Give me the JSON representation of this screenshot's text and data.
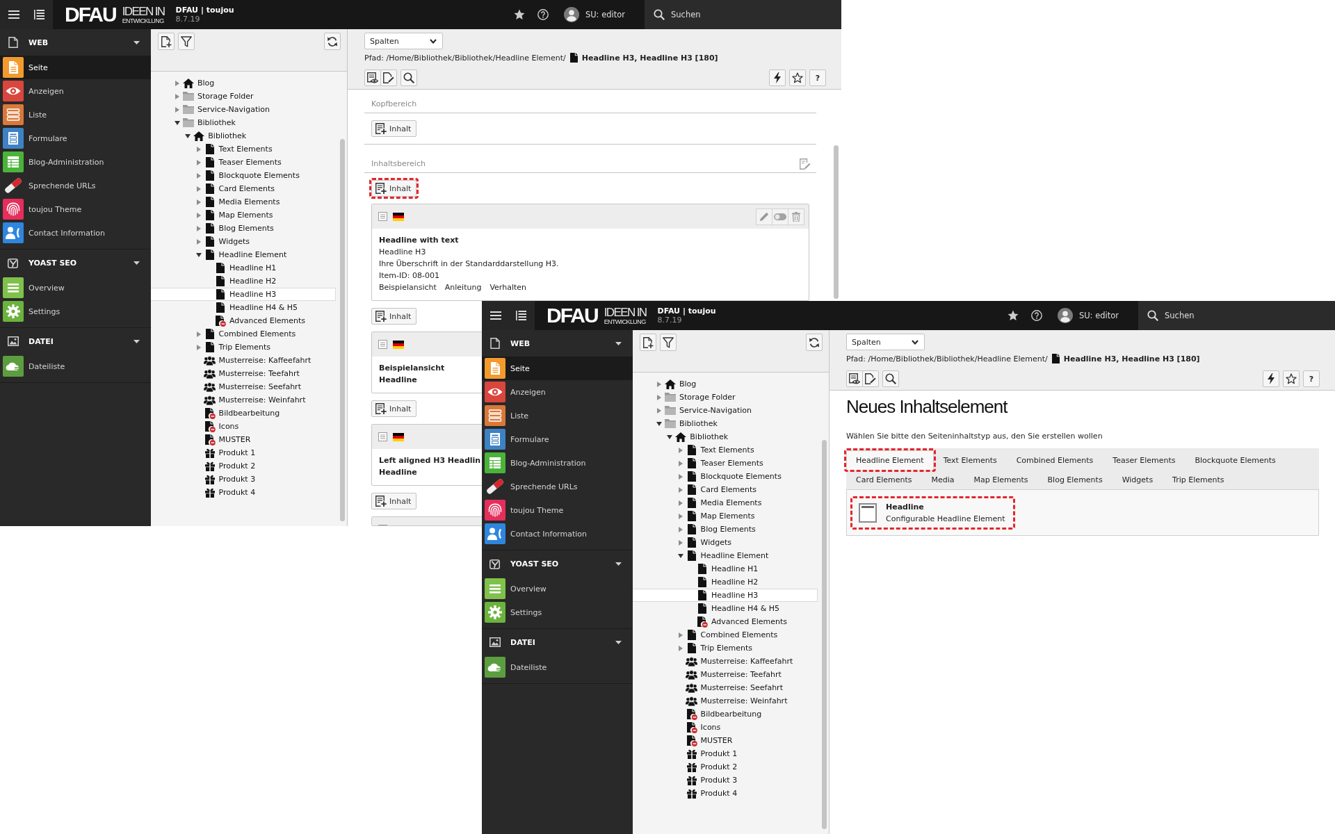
{
  "windows": [
    {
      "topbar": {
        "logo": {
          "wordmark": "DFAU",
          "tagline": "IDEEN IN",
          "subline": "ENTWICKLUNG"
        },
        "site_name": "DFAU | toujou",
        "version": "8.7.19",
        "user": "SU: editor",
        "search": "Suchen"
      },
      "sidebar": [
        {
          "title": "WEB",
          "kind": "web",
          "expanded": true,
          "items": [
            {
              "label": "Seite",
              "kind": "page",
              "color": "#f29a2e",
              "selected": true
            },
            {
              "label": "Anzeigen",
              "kind": "view",
              "color": "#d9463e",
              "selected": false
            },
            {
              "label": "Liste",
              "kind": "list",
              "color": "#d9783a",
              "selected": false
            },
            {
              "label": "Formulare",
              "kind": "form",
              "color": "#3d82c4",
              "selected": false
            },
            {
              "label": "Blog-Administration",
              "kind": "blog",
              "color": "#4bb33a",
              "selected": false
            },
            {
              "label": "Sprechende URLs",
              "kind": "urls",
              "selected": false
            },
            {
              "label": "toujou Theme",
              "kind": "theme",
              "color": "#e62e5c",
              "selected": false
            },
            {
              "label": "Contact Information",
              "kind": "contact",
              "color": "#2e86de",
              "selected": false
            }
          ]
        },
        {
          "title": "YOAST SEO",
          "kind": "seo",
          "expanded": true,
          "items": [
            {
              "label": "Overview",
              "kind": "overview",
              "color": "#7fc14b",
              "selected": false
            },
            {
              "label": "Settings",
              "kind": "settings",
              "color": "#6cb33e",
              "selected": false
            }
          ]
        },
        {
          "title": "DATEI",
          "kind": "file",
          "expanded": true,
          "items": [
            {
              "label": "Dateiliste",
              "kind": "filelist",
              "color": "#5c9e3f",
              "selected": false
            }
          ]
        }
      ],
      "page_tree": [
        {
          "label": "Blog",
          "kind": "root",
          "expanded": false,
          "selected": false
        },
        {
          "label": "Storage Folder",
          "kind": "folder",
          "expanded": false,
          "selected": false
        },
        {
          "label": "Service-Navigation",
          "kind": "folder",
          "expanded": false,
          "selected": false
        },
        {
          "label": "Bibliothek",
          "kind": "folder",
          "expanded": true,
          "selected": false,
          "children": [
            {
              "label": "Bibliothek",
              "kind": "root",
              "expanded": true,
              "selected": false,
              "children": [
                {
                  "label": "Text Elements",
                  "kind": "page",
                  "expanded": false,
                  "selected": false
                },
                {
                  "label": "Teaser Elements",
                  "kind": "page",
                  "expanded": false,
                  "selected": false
                },
                {
                  "label": "Blockquote Elements",
                  "kind": "page",
                  "expanded": false,
                  "selected": false
                },
                {
                  "label": "Card Elements",
                  "kind": "page",
                  "expanded": false,
                  "selected": false
                },
                {
                  "label": "Media Elements",
                  "kind": "page",
                  "expanded": false,
                  "selected": false
                },
                {
                  "label": "Map Elements",
                  "kind": "page",
                  "expanded": false,
                  "selected": false
                },
                {
                  "label": "Blog Elements",
                  "kind": "page",
                  "expanded": false,
                  "selected": false
                },
                {
                  "label": "Widgets",
                  "kind": "page",
                  "expanded": false,
                  "selected": false
                },
                {
                  "label": "Headline Element",
                  "kind": "page",
                  "expanded": true,
                  "selected": false,
                  "children": [
                    {
                      "label": "Headline H1",
                      "kind": "page",
                      "selected": false
                    },
                    {
                      "label": "Headline H2",
                      "kind": "page",
                      "selected": false
                    },
                    {
                      "label": "Headline H3",
                      "kind": "page",
                      "selected": true
                    },
                    {
                      "label": "Headline H4 & H5",
                      "kind": "page",
                      "selected": false
                    },
                    {
                      "label": "Advanced Elements",
                      "kind": "hidden",
                      "selected": false
                    }
                  ]
                },
                {
                  "label": "Combined Elements",
                  "kind": "page",
                  "expanded": false,
                  "selected": false
                },
                {
                  "label": "Trip Elements",
                  "kind": "page",
                  "expanded": false,
                  "selected": false
                },
                {
                  "label": "Musterreise: Kaffeefahrt",
                  "kind": "group",
                  "selected": false
                },
                {
                  "label": "Musterreise: Teefahrt",
                  "kind": "group",
                  "selected": false
                },
                {
                  "label": "Musterreise: Seefahrt",
                  "kind": "group",
                  "selected": false
                },
                {
                  "label": "Musterreise: Weinfahrt",
                  "kind": "group",
                  "selected": false
                },
                {
                  "label": "Bildbearbeitung",
                  "kind": "hidden",
                  "selected": false
                },
                {
                  "label": "Icons",
                  "kind": "hidden",
                  "selected": false
                },
                {
                  "label": "MUSTER",
                  "kind": "hidden",
                  "selected": false
                },
                {
                  "label": "Produkt 1",
                  "kind": "gift",
                  "selected": false
                },
                {
                  "label": "Produkt 2",
                  "kind": "gift",
                  "selected": false
                },
                {
                  "label": "Produkt 3",
                  "kind": "gift",
                  "selected": false
                },
                {
                  "label": "Produkt 4",
                  "kind": "gift",
                  "selected": false
                }
              ]
            }
          ]
        }
      ],
      "docheader": {
        "view_select": "Spalten",
        "path": "Pfad: /Home/Bibliothek/Bibliothek/Headline Element/",
        "page_title": "Headline H3, Headline H3 [180]",
        "help": "?"
      },
      "content": {
        "kind": "page_layout",
        "columns": [
          {
            "title": "Kopfbereich",
            "editable": false,
            "items": [
              {
                "kind": "add",
                "label": "Inhalt",
                "highlighted": false
              }
            ]
          },
          {
            "title": "Inhaltsbereich",
            "editable": true,
            "items": [
              {
                "kind": "add",
                "label": "Inhalt",
                "highlighted": true
              },
              {
                "kind": "card",
                "title_lines": [
                  "Headline with text"
                ],
                "lines": [
                  "Headline H3",
                  "Ihre Überschrift in der Standarddarstellung H3.",
                  "Item-ID: 08-001"
                ],
                "tags": [
                  "Beispielansicht",
                  "Anleitung",
                  "Verhalten"
                ]
              },
              {
                "kind": "add",
                "label": "Inhalt",
                "highlighted": false
              },
              {
                "kind": "card",
                "title_lines": [
                  "Beispielansicht",
                  "Headline"
                ]
              },
              {
                "kind": "add",
                "label": "Inhalt",
                "highlighted": false
              },
              {
                "kind": "card",
                "title_lines": [
                  "Left aligned H3 Headlin",
                  "Headline"
                ]
              },
              {
                "kind": "add",
                "label": "Inhalt",
                "highlighted": false
              },
              {
                "kind": "card"
              }
            ]
          }
        ]
      }
    },
    {
      "topbar": {
        "logo": {
          "wordmark": "DFAU",
          "tagline": "IDEEN IN",
          "subline": "ENTWICKLUNG"
        },
        "site_name": "DFAU | toujou",
        "version": "8.7.19",
        "user": "SU: editor",
        "search": "Suchen"
      },
      "sidebar": [
        {
          "title": "WEB",
          "kind": "web",
          "expanded": true,
          "items": [
            {
              "label": "Seite",
              "kind": "page",
              "color": "#f29a2e",
              "selected": true
            },
            {
              "label": "Anzeigen",
              "kind": "view",
              "color": "#d9463e",
              "selected": false
            },
            {
              "label": "Liste",
              "kind": "list",
              "color": "#d9783a",
              "selected": false
            },
            {
              "label": "Formulare",
              "kind": "form",
              "color": "#3d82c4",
              "selected": false
            },
            {
              "label": "Blog-Administration",
              "kind": "blog",
              "color": "#4bb33a",
              "selected": false
            },
            {
              "label": "Sprechende URLs",
              "kind": "urls",
              "selected": false
            },
            {
              "label": "toujou Theme",
              "kind": "theme",
              "color": "#e62e5c",
              "selected": false
            },
            {
              "label": "Contact Information",
              "kind": "contact",
              "color": "#2e86de",
              "selected": false
            }
          ]
        },
        {
          "title": "YOAST SEO",
          "kind": "seo",
          "expanded": true,
          "items": [
            {
              "label": "Overview",
              "kind": "overview",
              "color": "#7fc14b",
              "selected": false
            },
            {
              "label": "Settings",
              "kind": "settings",
              "color": "#6cb33e",
              "selected": false
            }
          ]
        },
        {
          "title": "DATEI",
          "kind": "file",
          "expanded": true,
          "items": [
            {
              "label": "Dateiliste",
              "kind": "filelist",
              "color": "#5c9e3f",
              "selected": false
            }
          ]
        }
      ],
      "page_tree": [
        {
          "label": "Blog",
          "kind": "root",
          "expanded": false,
          "selected": false
        },
        {
          "label": "Storage Folder",
          "kind": "folder",
          "expanded": false,
          "selected": false
        },
        {
          "label": "Service-Navigation",
          "kind": "folder",
          "expanded": false,
          "selected": false
        },
        {
          "label": "Bibliothek",
          "kind": "folder",
          "expanded": true,
          "selected": false,
          "children": [
            {
              "label": "Bibliothek",
              "kind": "root",
              "expanded": true,
              "selected": false,
              "children": [
                {
                  "label": "Text Elements",
                  "kind": "page",
                  "expanded": false,
                  "selected": false
                },
                {
                  "label": "Teaser Elements",
                  "kind": "page",
                  "expanded": false,
                  "selected": false
                },
                {
                  "label": "Blockquote Elements",
                  "kind": "page",
                  "expanded": false,
                  "selected": false
                },
                {
                  "label": "Card Elements",
                  "kind": "page",
                  "expanded": false,
                  "selected": false
                },
                {
                  "label": "Media Elements",
                  "kind": "page",
                  "expanded": false,
                  "selected": false
                },
                {
                  "label": "Map Elements",
                  "kind": "page",
                  "expanded": false,
                  "selected": false
                },
                {
                  "label": "Blog Elements",
                  "kind": "page",
                  "expanded": false,
                  "selected": false
                },
                {
                  "label": "Widgets",
                  "kind": "page",
                  "expanded": false,
                  "selected": false
                },
                {
                  "label": "Headline Element",
                  "kind": "page",
                  "expanded": true,
                  "selected": false,
                  "children": [
                    {
                      "label": "Headline H1",
                      "kind": "page",
                      "selected": false
                    },
                    {
                      "label": "Headline H2",
                      "kind": "page",
                      "selected": false
                    },
                    {
                      "label": "Headline H3",
                      "kind": "page",
                      "selected": true
                    },
                    {
                      "label": "Headline H4 & H5",
                      "kind": "page",
                      "selected": false
                    },
                    {
                      "label": "Advanced Elements",
                      "kind": "hidden",
                      "selected": false
                    }
                  ]
                },
                {
                  "label": "Combined Elements",
                  "kind": "page",
                  "expanded": false,
                  "selected": false
                },
                {
                  "label": "Trip Elements",
                  "kind": "page",
                  "expanded": false,
                  "selected": false
                },
                {
                  "label": "Musterreise: Kaffeefahrt",
                  "kind": "group",
                  "selected": false
                },
                {
                  "label": "Musterreise: Teefahrt",
                  "kind": "group",
                  "selected": false
                },
                {
                  "label": "Musterreise: Seefahrt",
                  "kind": "group",
                  "selected": false
                },
                {
                  "label": "Musterreise: Weinfahrt",
                  "kind": "group",
                  "selected": false
                },
                {
                  "label": "Bildbearbeitung",
                  "kind": "hidden",
                  "selected": false
                },
                {
                  "label": "Icons",
                  "kind": "hidden",
                  "selected": false
                },
                {
                  "label": "MUSTER",
                  "kind": "hidden",
                  "selected": false
                },
                {
                  "label": "Produkt 1",
                  "kind": "gift",
                  "selected": false
                },
                {
                  "label": "Produkt 2",
                  "kind": "gift",
                  "selected": false
                },
                {
                  "label": "Produkt 3",
                  "kind": "gift",
                  "selected": false
                },
                {
                  "label": "Produkt 4",
                  "kind": "gift",
                  "selected": false
                }
              ]
            }
          ]
        }
      ],
      "docheader": {
        "view_select": "Spalten",
        "path": "Pfad: /Home/Bibliothek/Bibliothek/Headline Element/",
        "page_title": "Headline H3, Headline H3 [180]",
        "help": "?"
      },
      "content": {
        "kind": "wizard",
        "title": "Neues Inhaltselement",
        "intro": "Wählen Sie bitte den Seiteninhaltstyp aus, den Sie erstellen wollen",
        "tabs": [
          {
            "label": "Headline Element",
            "selected": true,
            "highlighted": true
          },
          {
            "label": "Text Elements",
            "selected": false,
            "highlighted": false
          },
          {
            "label": "Combined Elements",
            "selected": false,
            "highlighted": false
          },
          {
            "label": "Teaser Elements",
            "selected": false,
            "highlighted": false
          },
          {
            "label": "Blockquote Elements",
            "selected": false,
            "highlighted": false
          },
          {
            "label": "Card Elements",
            "selected": false,
            "highlighted": false
          },
          {
            "label": "Media",
            "selected": false,
            "highlighted": false
          },
          {
            "label": "Map Elements",
            "selected": false,
            "highlighted": false
          },
          {
            "label": "Blog Elements",
            "selected": false,
            "highlighted": false
          },
          {
            "label": "Widgets",
            "selected": false,
            "highlighted": false
          },
          {
            "label": "Trip Elements",
            "selected": false,
            "highlighted": false
          }
        ],
        "options": [
          {
            "title": "Headline",
            "description": "Configurable Headline Element",
            "highlighted": true
          }
        ]
      }
    }
  ]
}
